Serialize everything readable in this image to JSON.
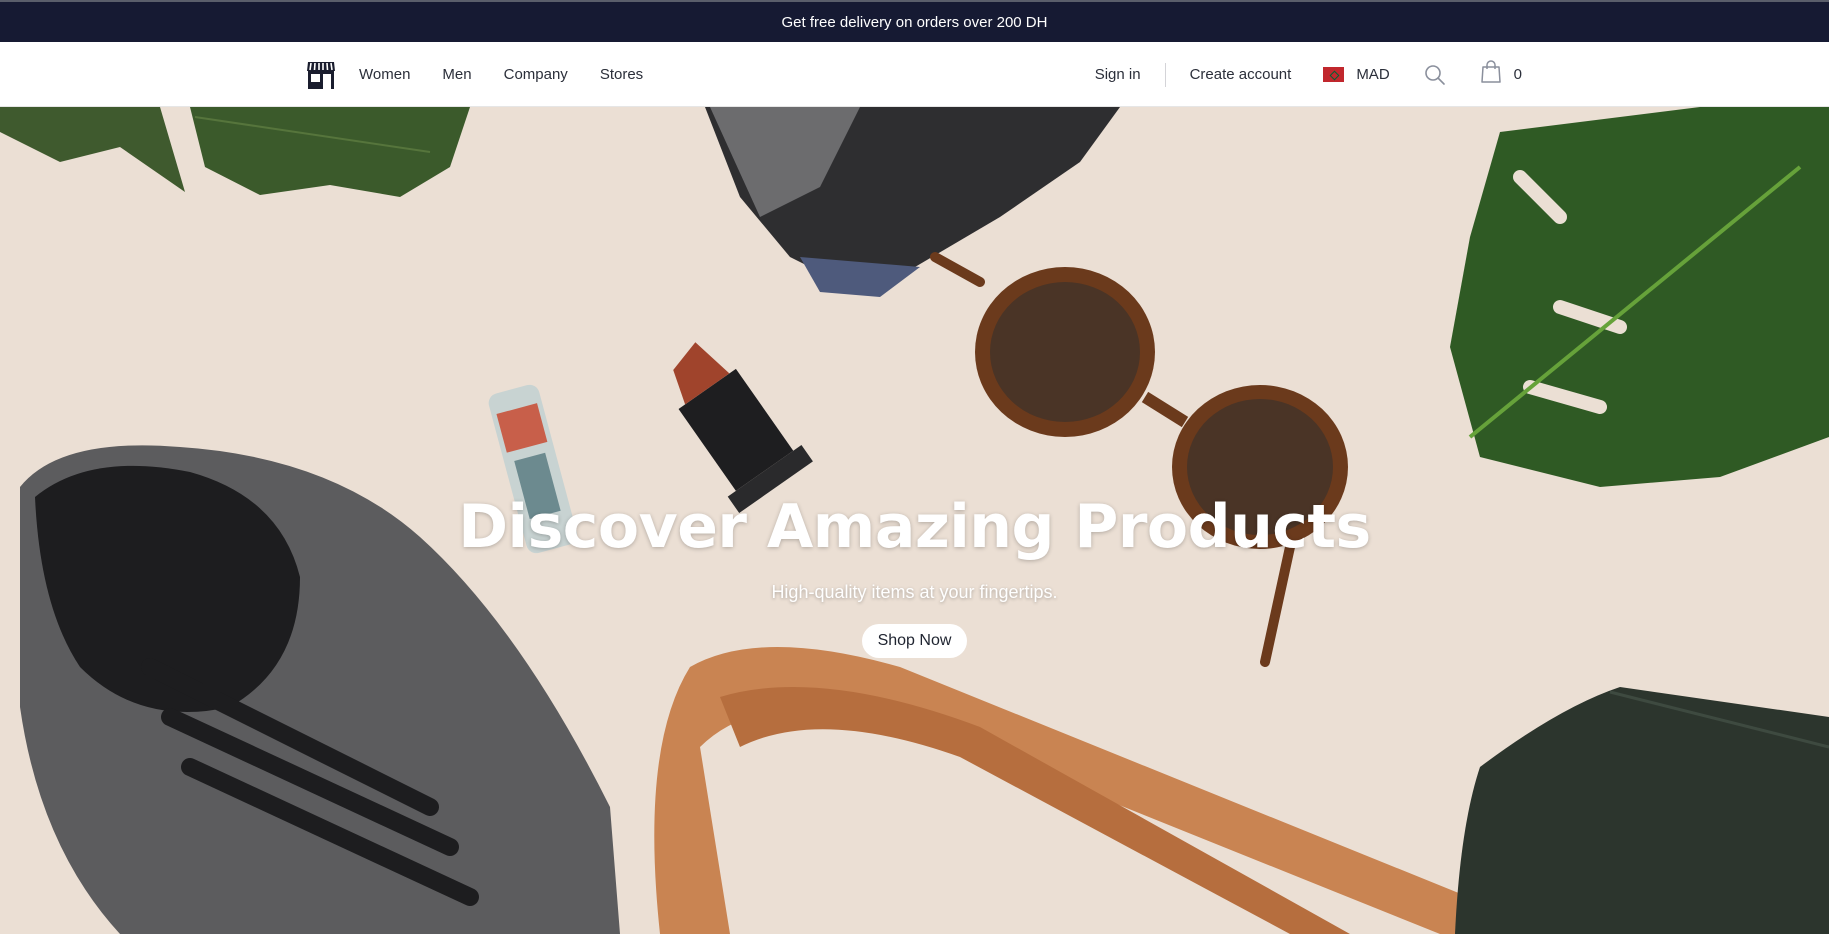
{
  "promo": {
    "text": "Get free delivery on orders over 200 DH"
  },
  "nav": {
    "logo_icon": "storefront-icon",
    "links": [
      {
        "label": "Women"
      },
      {
        "label": "Men"
      },
      {
        "label": "Company"
      },
      {
        "label": "Stores"
      }
    ],
    "sign_in": "Sign in",
    "create_account": "Create account",
    "currency": {
      "code": "MAD",
      "flag_icon": "morocco-flag-icon"
    },
    "search_icon": "search-icon",
    "cart": {
      "icon": "shopping-bag-icon",
      "count": "0"
    }
  },
  "hero": {
    "title": "Discover Amazing Products",
    "subtitle": "High-quality items at your fingertips.",
    "cta_label": "Shop Now",
    "background_description_icon": "flatlay-products-image"
  },
  "colors": {
    "promo_bg": "#161a33",
    "hero_bg": "#ebdfd4",
    "flag_red": "#c1272d",
    "flag_green": "#006233"
  }
}
